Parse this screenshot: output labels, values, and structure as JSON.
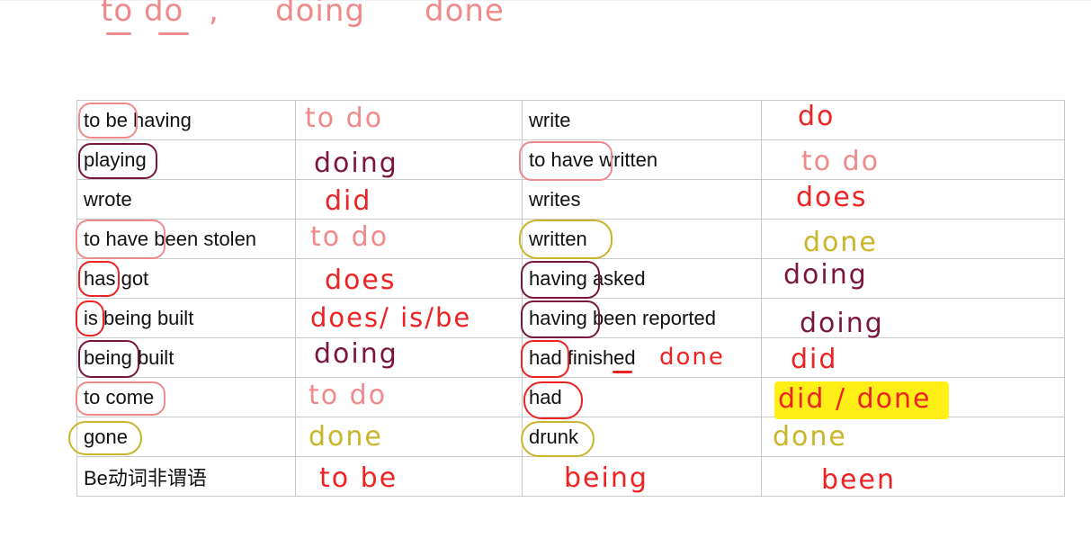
{
  "heading_annotation": {
    "todo": "to do",
    "comma": ",",
    "doing": "doing",
    "done": "done"
  },
  "colors": {
    "pink": "#f08a8a",
    "red": "#ee2222",
    "maroon": "#7a1540",
    "olive": "#c8b52a",
    "highlight": "#ffef16"
  },
  "table": {
    "rows": [
      {
        "c1": "to be having",
        "c2": "to do",
        "c3": "write",
        "c4": "do"
      },
      {
        "c1": "playing",
        "c2": "doing",
        "c3": "to have written",
        "c4": "to do"
      },
      {
        "c1": "wrote",
        "c2": "did",
        "c3": "writes",
        "c4": "does"
      },
      {
        "c1": "to have been stolen",
        "c2": "to do",
        "c3": "written",
        "c4": "done"
      },
      {
        "c1": "has got",
        "c2": "does",
        "c3": "having asked",
        "c4": "doing"
      },
      {
        "c1": "is being built",
        "c2": "does/ is/be",
        "c3": "having been reported",
        "c4": "doing"
      },
      {
        "c1": "being built",
        "c2": "doing",
        "c3": "had finished",
        "c3_note": "done",
        "c4": "did"
      },
      {
        "c1": "to come",
        "c2": "to do",
        "c3": "had",
        "c4": "did / done"
      },
      {
        "c1": "gone",
        "c2": "done",
        "c3": "drunk",
        "c4": "done"
      },
      {
        "c1": "Be动词非谓语",
        "c2": "to be",
        "c3": "being",
        "c4": "been"
      }
    ]
  }
}
